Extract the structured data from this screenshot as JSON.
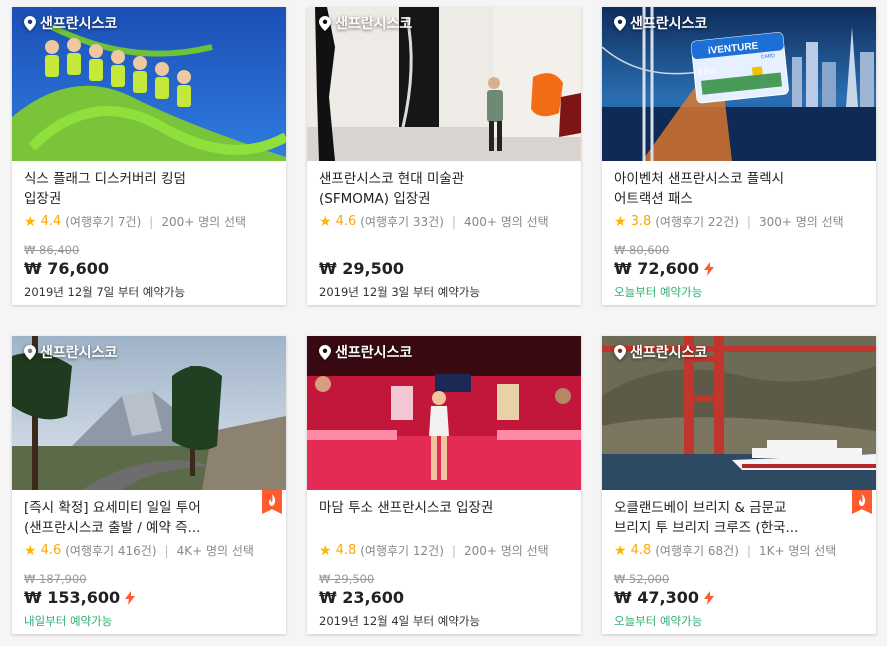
{
  "cards": [
    {
      "location": "샌프란시스코",
      "title_line1": "식스 플래그 디스커버리 킹덤",
      "title_line2": "입장권",
      "score": "4.4",
      "reviews": "(여행후기 7건)",
      "popularity": "200+ 명의 선택",
      "old_price": "₩ 86,400",
      "price": "₩ 76,600",
      "availability": "2019년 12월 7일 부터 예약가능",
      "instant": false,
      "badge": false
    },
    {
      "location": "샌프란시스코",
      "title_line1": "샌프란시스코 현대 미술관",
      "title_line2": "(SFMOMA) 입장권",
      "score": "4.6",
      "reviews": "(여행후기 33건)",
      "popularity": "400+ 명의 선택",
      "old_price": "",
      "price": "₩ 29,500",
      "availability": "2019년 12월 3일 부터 예약가능",
      "instant": false,
      "badge": false
    },
    {
      "location": "샌프란시스코",
      "title_line1": "아이벤처 샌프란시스코 플렉시",
      "title_line2": "어트랙션 패스",
      "score": "3.8",
      "reviews": "(여행후기 22건)",
      "popularity": "300+ 명의 선택",
      "old_price": "₩ 80,600",
      "price": "₩ 72,600",
      "availability": "오늘부터 예약가능",
      "instant": true,
      "badge": false,
      "image_text": {
        "brand": "iVENTURE",
        "sub": "CARD",
        "flexi": "Flexi"
      }
    },
    {
      "location": "샌프란시스코",
      "title_line1": "[즉시 확정] 요세미티 일일 투어",
      "title_line2": "(샌프란시스코 출발 / 예약 즉...",
      "score": "4.6",
      "reviews": "(여행후기 416건)",
      "popularity": "4K+ 명의 선택",
      "old_price": "₩ 187,900",
      "price": "₩ 153,600",
      "availability": "내일부터 예약가능",
      "instant": true,
      "badge": true
    },
    {
      "location": "샌프란시스코",
      "title_line1": "마담 투소 샌프란시스코 입장권",
      "title_line2": "",
      "score": "4.8",
      "reviews": "(여행후기 12건)",
      "popularity": "200+ 명의 선택",
      "old_price": "₩ 29,500",
      "price": "₩ 23,600",
      "availability": "2019년 12월 4일 부터 예약가능",
      "instant": false,
      "badge": false
    },
    {
      "location": "샌프란시스코",
      "title_line1": "오클랜드베이 브리지 & 금문교",
      "title_line2": "브리지 투 브리지 크루즈 (한국...",
      "score": "4.8",
      "reviews": "(여행후기 68건)",
      "popularity": "1K+ 명의 선택",
      "old_price": "₩ 52,000",
      "price": "₩ 47,300",
      "availability": "오늘부터 예약가능",
      "instant": true,
      "badge": true
    }
  ],
  "colors": {
    "star": "#ffb400",
    "score": "#ffa600",
    "available_today": "#2eaf74",
    "instant_bolt": "#ff5b2e"
  }
}
